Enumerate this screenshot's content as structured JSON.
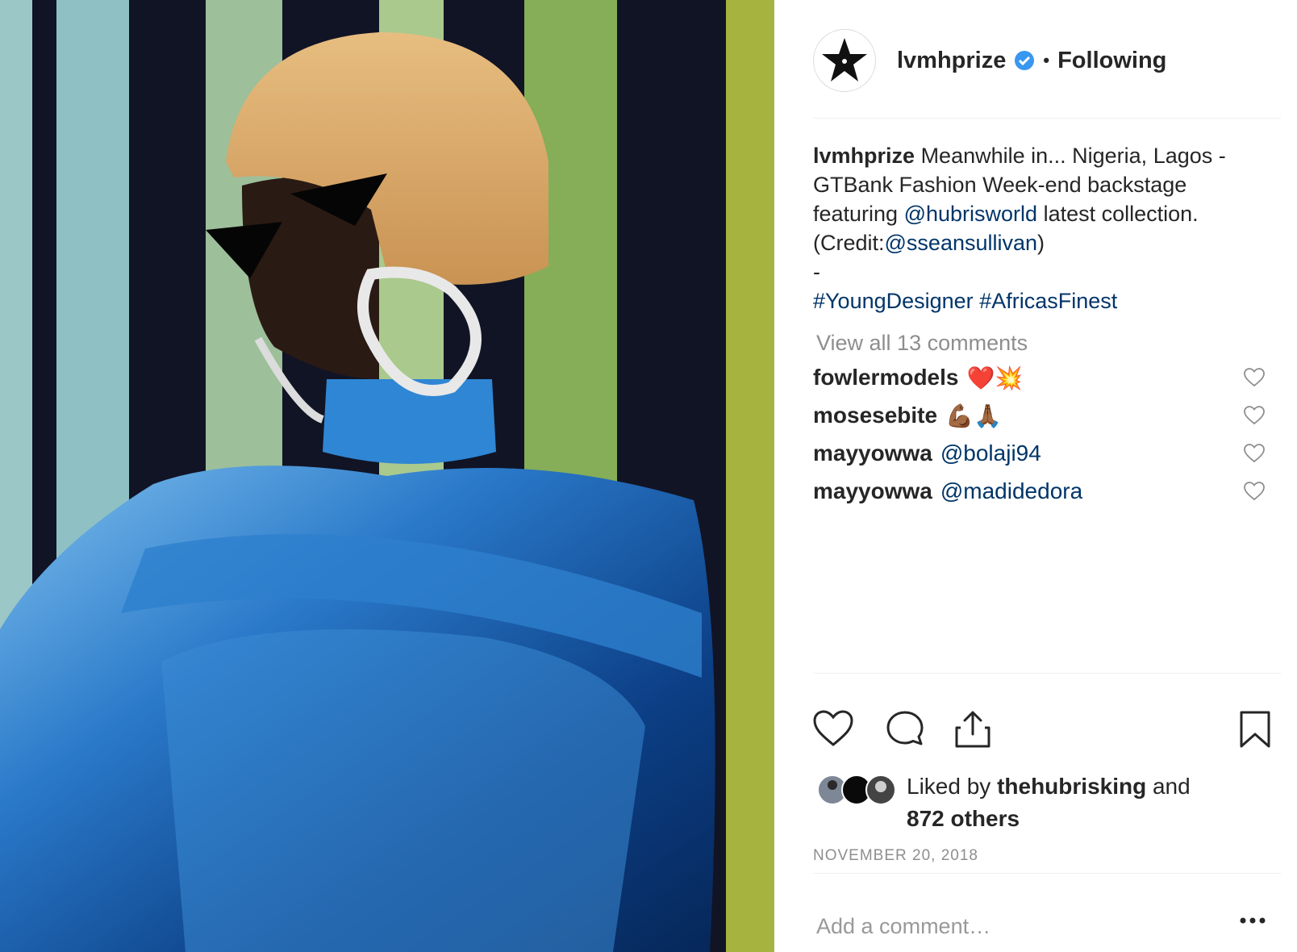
{
  "post": {
    "image_alt": "Model in blue metallic outfit with blonde bob wig and sunglasses in front of striped wall"
  },
  "header": {
    "username": "lvmhprize",
    "separator": "•",
    "follow_state": "Following"
  },
  "caption": {
    "username": "lvmhprize",
    "text_1": "Meanwhile in... Nigeria, Lagos - GTBank Fashion Week-end backstage featuring",
    "mention_1": "@hubrisworld",
    "text_2": "latest collection. (Credit:",
    "mention_2": "@sseansullivan",
    "text_3": ")",
    "dash": "-",
    "hashtag_1": "#YoungDesigner",
    "hashtag_2": "#AfricasFinest"
  },
  "comments": {
    "view_all": "View all 13 comments",
    "items": [
      {
        "user": "fowlermodels",
        "text": "❤️💥"
      },
      {
        "user": "mosesebite",
        "text": "💪🏾🙏🏾"
      },
      {
        "user": "mayyowwa",
        "text": "@bolaji94"
      },
      {
        "user": "mayyowwa",
        "text": "@madidedora"
      }
    ]
  },
  "likes": {
    "prefix": "Liked by",
    "user": "thehubrisking",
    "conj": "and",
    "others": "872 others"
  },
  "date": "NOVEMBER 20, 2018",
  "add_comment": {
    "placeholder": "Add a comment…"
  },
  "icons": {
    "like": "heart-icon",
    "comment": "comment-icon",
    "share": "share-icon",
    "save": "bookmark-icon",
    "more": "more-icon"
  }
}
